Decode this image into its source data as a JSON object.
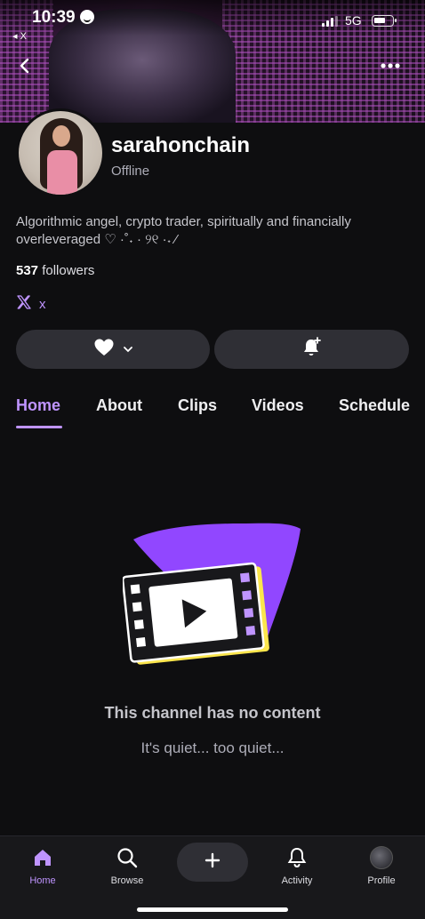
{
  "status_bar": {
    "time": "10:39",
    "back_app": "◂ X",
    "network": "5G"
  },
  "channel": {
    "username": "sarahonchain",
    "status": "Offline",
    "bio": "Algorithmic angel, crypto trader, spiritually and financially overleveraged ♡ ·˚˖ · ୨୧ ·˖ ⁄",
    "followers_count": "537",
    "followers_label": "followers",
    "social_label": "x"
  },
  "tabs": [
    {
      "label": "Home",
      "active": true
    },
    {
      "label": "About"
    },
    {
      "label": "Clips"
    },
    {
      "label": "Videos"
    },
    {
      "label": "Schedule"
    }
  ],
  "empty_state": {
    "title": "This channel has no content",
    "subtitle": "It's quiet... too quiet..."
  },
  "bottom_nav": {
    "home": "Home",
    "browse": "Browse",
    "activity": "Activity",
    "profile": "Profile"
  },
  "colors": {
    "accent": "#bf94ff",
    "background": "#0e0e10",
    "button": "#2f2f35"
  },
  "icons": [
    "back-icon",
    "more-icon",
    "heart-icon",
    "chevron-down-icon",
    "bell-plus-icon",
    "x-logo-icon",
    "video-icon",
    "home-icon",
    "search-icon",
    "plus-icon",
    "bell-icon"
  ]
}
